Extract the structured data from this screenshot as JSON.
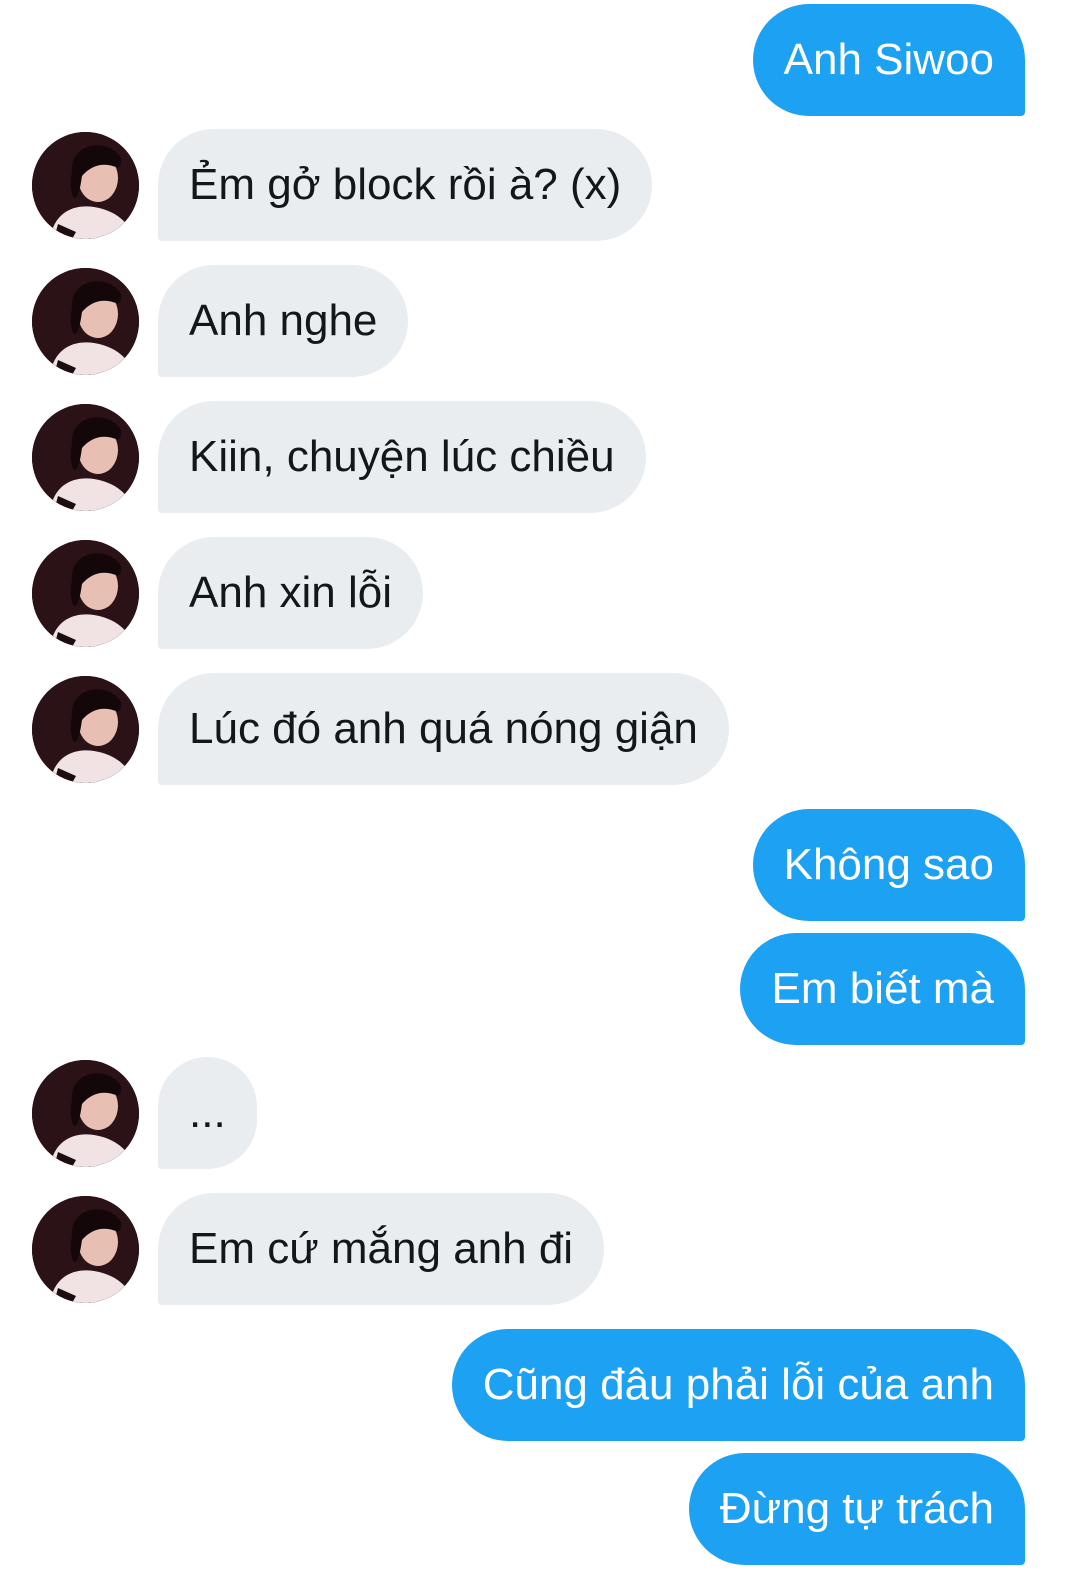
{
  "conversation": {
    "messages": [
      {
        "sender": "me",
        "text": "Anh Siwoo"
      },
      {
        "sender": "other",
        "text": "Ẻm gở block rồi à? (x)"
      },
      {
        "sender": "other",
        "text": "Anh nghe"
      },
      {
        "sender": "other",
        "text": "Kiin, chuyện lúc chiều"
      },
      {
        "sender": "other",
        "text": "Anh xin lỗi"
      },
      {
        "sender": "other",
        "text": "Lúc đó anh quá nóng giận"
      },
      {
        "sender": "me",
        "text": "Không sao"
      },
      {
        "sender": "me",
        "text": "Em biết mà"
      },
      {
        "sender": "other",
        "text": "..."
      },
      {
        "sender": "other",
        "text": "Em cứ mắng anh đi"
      },
      {
        "sender": "me",
        "text": "Cũng đâu phải lỗi của anh"
      },
      {
        "sender": "me",
        "text": "Đừng tự trách"
      }
    ]
  },
  "colors": {
    "sent_bubble": "#1da1f2",
    "received_bubble": "#e9edf0",
    "background": "#ffffff"
  },
  "icons": {
    "avatar": "contact-avatar"
  }
}
